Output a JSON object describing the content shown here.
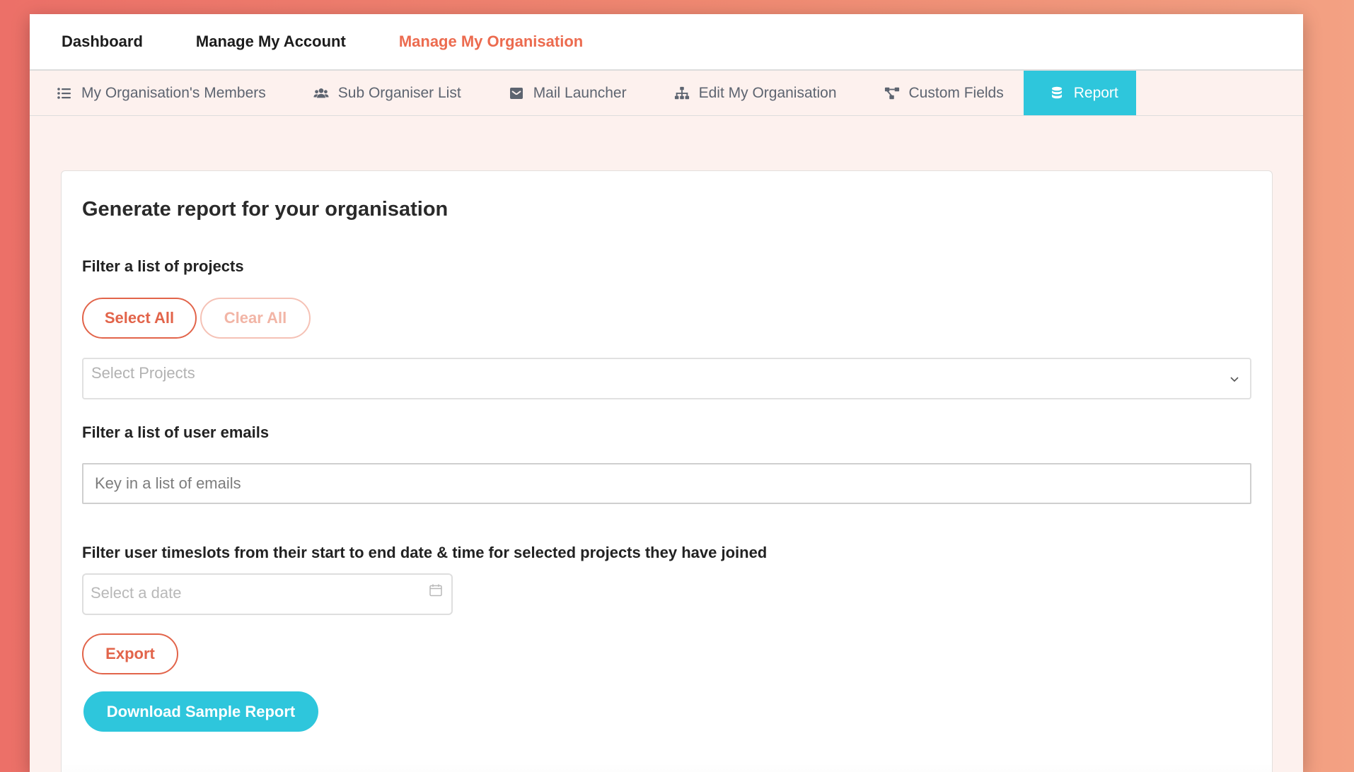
{
  "topnav": {
    "items": [
      {
        "label": "Dashboard"
      },
      {
        "label": "Manage My Account"
      },
      {
        "label": "Manage My Organisation"
      }
    ],
    "active_color": "#ec6b4f"
  },
  "subnav": {
    "tabs": [
      {
        "label": "My Organisation's Members",
        "icon": "list-icon"
      },
      {
        "label": "Sub Organiser List",
        "icon": "users-icon"
      },
      {
        "label": "Mail Launcher",
        "icon": "envelope-icon"
      },
      {
        "label": "Edit My Organisation",
        "icon": "sitemap-icon"
      },
      {
        "label": "Custom Fields",
        "icon": "project-diagram-icon"
      },
      {
        "label": "Report",
        "icon": "database-icon"
      }
    ],
    "active_tab": "Report",
    "active_color": "#2ec6dc"
  },
  "report": {
    "title": "Generate report for your organisation",
    "projects": {
      "label": "Filter a list of projects",
      "select_all": "Select All",
      "clear_all": "Clear All",
      "placeholder": "Select Projects"
    },
    "emails": {
      "label": "Filter a list of user emails",
      "placeholder": "Key in a list of emails",
      "value": ""
    },
    "timeslots": {
      "label": "Filter user timeslots from their start to end date & time for selected projects they have joined",
      "date_placeholder": "Select a date"
    },
    "export_label": "Export",
    "download_label": "Download Sample Report"
  }
}
